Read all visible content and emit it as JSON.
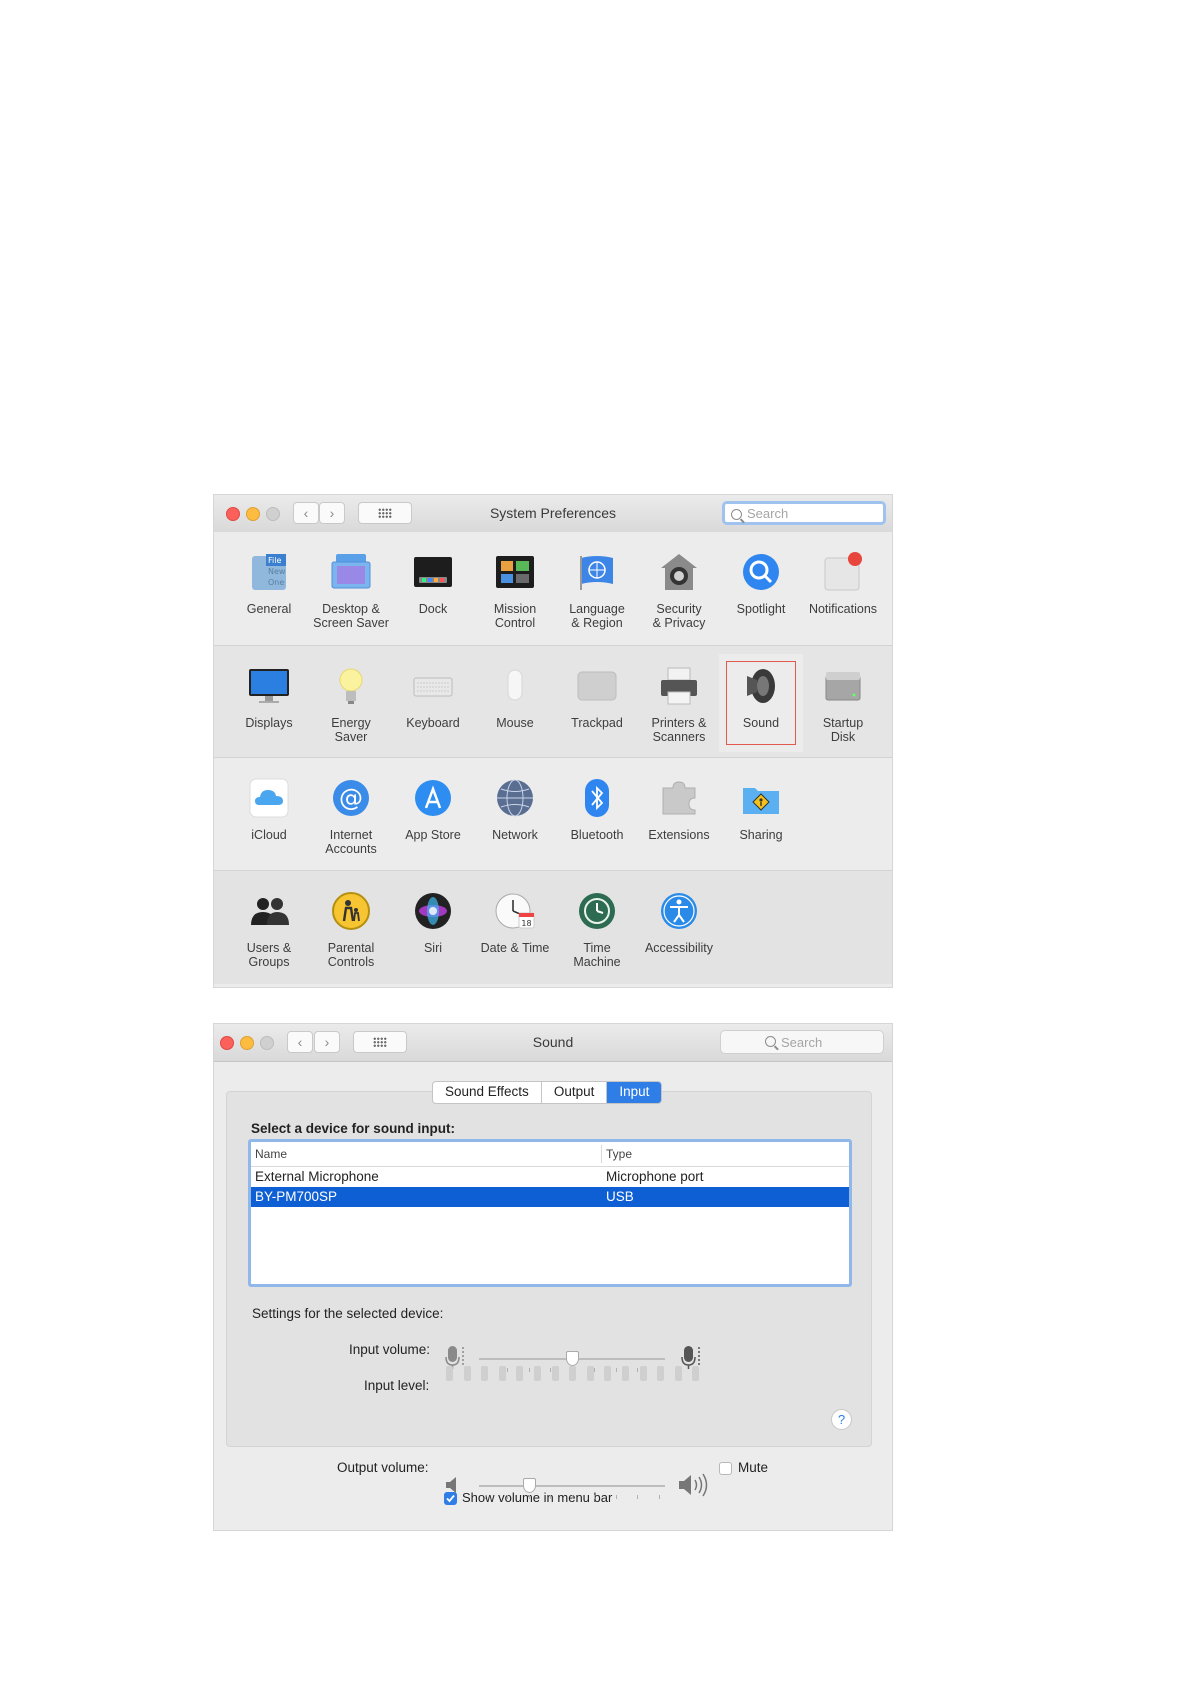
{
  "sys_prefs": {
    "title": "System Preferences",
    "search_placeholder": "Search",
    "rows": [
      [
        {
          "label": "General",
          "icon": "general-icon"
        },
        {
          "label": "Desktop &\nScreen Saver",
          "icon": "desktop-icon"
        },
        {
          "label": "Dock",
          "icon": "dock-icon"
        },
        {
          "label": "Mission\nControl",
          "icon": "mission-control-icon"
        },
        {
          "label": "Language\n& Region",
          "icon": "flag-icon"
        },
        {
          "label": "Security\n& Privacy",
          "icon": "house-lock-icon"
        },
        {
          "label": "Spotlight",
          "icon": "magnifier-icon"
        },
        {
          "label": "Notifications",
          "icon": "notifications-icon"
        }
      ],
      [
        {
          "label": "Displays",
          "icon": "display-icon"
        },
        {
          "label": "Energy\nSaver",
          "icon": "lightbulb-icon"
        },
        {
          "label": "Keyboard",
          "icon": "keyboard-icon"
        },
        {
          "label": "Mouse",
          "icon": "mouse-icon"
        },
        {
          "label": "Trackpad",
          "icon": "trackpad-icon"
        },
        {
          "label": "Printers &\nScanners",
          "icon": "printer-icon"
        },
        {
          "label": "Sound",
          "icon": "speaker-icon"
        },
        {
          "label": "Startup\nDisk",
          "icon": "hard-disk-icon"
        }
      ],
      [
        {
          "label": "iCloud",
          "icon": "cloud-icon"
        },
        {
          "label": "Internet\nAccounts",
          "icon": "at-sign-icon"
        },
        {
          "label": "App Store",
          "icon": "app-store-icon"
        },
        {
          "label": "Network",
          "icon": "globe-icon"
        },
        {
          "label": "Bluetooth",
          "icon": "bluetooth-icon"
        },
        {
          "label": "Extensions",
          "icon": "puzzle-icon"
        },
        {
          "label": "Sharing",
          "icon": "sharing-folder-icon"
        }
      ],
      [
        {
          "label": "Users &\nGroups",
          "icon": "users-icon"
        },
        {
          "label": "Parental\nControls",
          "icon": "parental-icon"
        },
        {
          "label": "Siri",
          "icon": "siri-icon"
        },
        {
          "label": "Date & Time",
          "icon": "clock-icon"
        },
        {
          "label": "Time\nMachine",
          "icon": "time-machine-icon"
        },
        {
          "label": "Accessibility",
          "icon": "accessibility-icon"
        }
      ]
    ],
    "highlighted": "Sound",
    "icon_file_lines": [
      "File",
      "New",
      "One"
    ],
    "calendar_day": "18"
  },
  "sound": {
    "title": "Sound",
    "search_placeholder": "Search",
    "tabs": [
      {
        "label": "Sound Effects",
        "active": false
      },
      {
        "label": "Output",
        "active": false
      },
      {
        "label": "Input",
        "active": true
      }
    ],
    "select_heading": "Select a device for sound input:",
    "columns": [
      "Name",
      "Type"
    ],
    "devices": [
      {
        "name": "External Microphone",
        "type": "Microphone port",
        "selected": false
      },
      {
        "name": "BY-PM700SP",
        "type": "USB",
        "selected": true
      }
    ],
    "settings_heading": "Settings for the selected device:",
    "input_volume_label": "Input volume:",
    "input_volume": 0.5,
    "input_level_label": "Input level:",
    "input_level_segments": 15,
    "input_level_active": 0,
    "output_volume_label": "Output volume:",
    "output_volume": 0.27,
    "mute_label": "Mute",
    "mute_checked": false,
    "show_volume_label": "Show volume in menu bar",
    "show_volume_checked": true,
    "help_glyph": "?"
  },
  "colors": {
    "accent": "#2f7ee8",
    "selection": "#0e5fd3",
    "highlight_border": "#e05a4f"
  }
}
